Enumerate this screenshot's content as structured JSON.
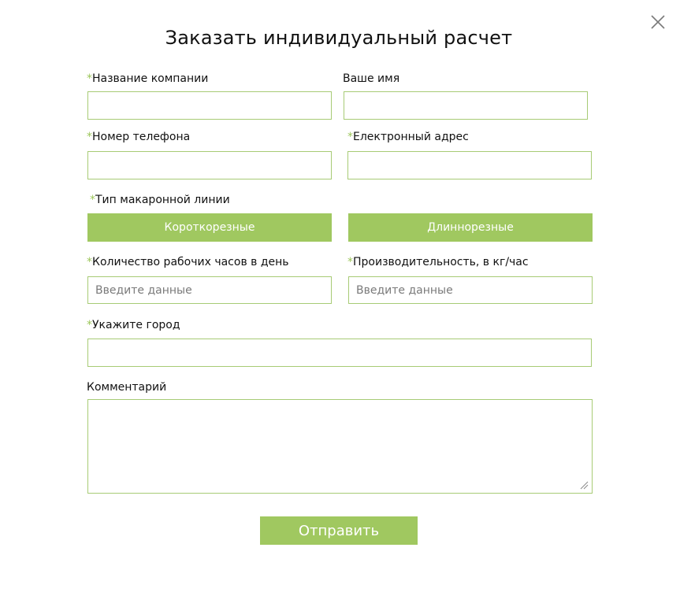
{
  "dialog": {
    "title": "Заказать индивидуальный расчет",
    "close_icon": "close-icon"
  },
  "form": {
    "required_mark": "*",
    "company_name": {
      "label": "Название компании",
      "value": "",
      "required": true
    },
    "your_name": {
      "label": "Ваше имя",
      "value": "",
      "required": false
    },
    "phone": {
      "label": "Номер телефона",
      "value": "",
      "required": true
    },
    "email": {
      "label": "Електронный адрес",
      "value": "",
      "required": true
    },
    "line_type": {
      "label": "Тип макаронной линии",
      "required": true,
      "options": [
        "Короткорезные",
        "Длиннорезные"
      ]
    },
    "work_hours": {
      "label": "Количество рабочих часов в день",
      "value": "",
      "placeholder": "Введите данные",
      "required": true
    },
    "productivity": {
      "label": "Производительность, в кг/час",
      "value": "",
      "placeholder": "Введите данные",
      "required": true
    },
    "city": {
      "label": "Укажите город",
      "value": "",
      "required": true
    },
    "comment": {
      "label": "Комментарий",
      "value": "",
      "required": false
    },
    "submit_label": "Отправить"
  },
  "colors": {
    "accent": "#a0c860",
    "field_border": "#a7cb75",
    "required_mark": "#9cc65a",
    "text": "#111111",
    "placeholder": "#7a7a7a"
  }
}
